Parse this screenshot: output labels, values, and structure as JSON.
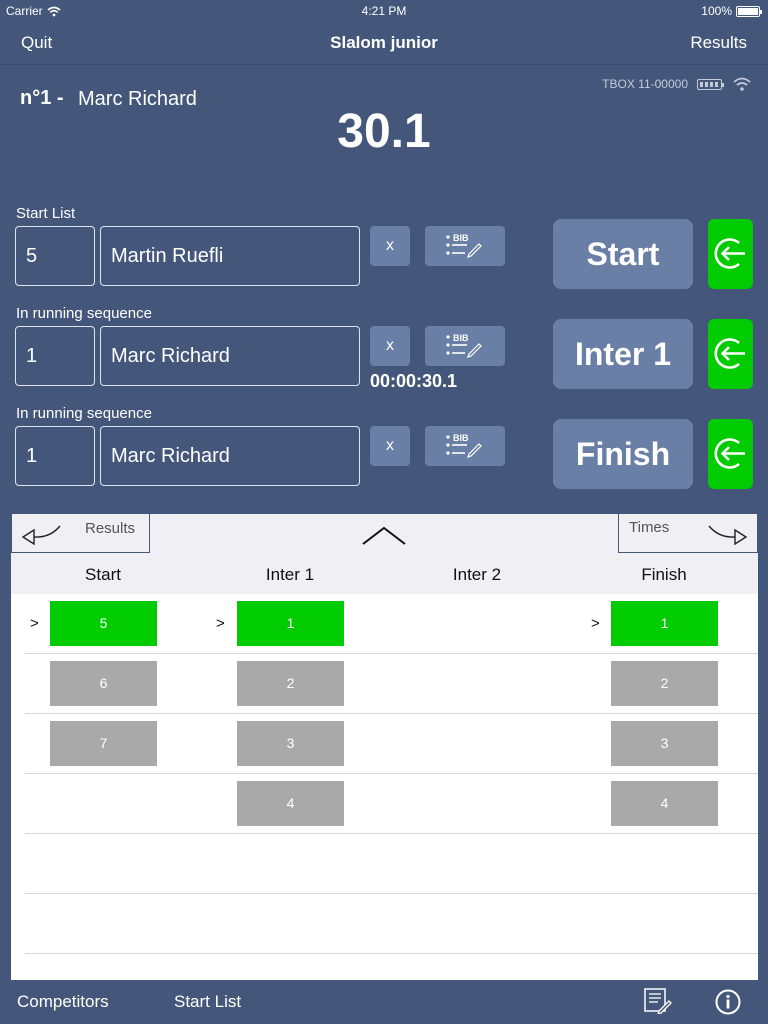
{
  "status_bar": {
    "carrier": "Carrier",
    "time": "4:21 PM",
    "battery": "100%"
  },
  "nav": {
    "quit": "Quit",
    "title": "Slalom junior",
    "results": "Results"
  },
  "device": {
    "id": "TBOX 11-00000"
  },
  "current_runner": {
    "number": "n°1 -",
    "name": "Marc Richard",
    "time": "30.1"
  },
  "rows": [
    {
      "label": "Start List",
      "bib": "5",
      "name": "Martin Ruefli",
      "clear": "x",
      "bib_icon_text": "BIB",
      "action": "Start",
      "time": ""
    },
    {
      "label": "In running sequence",
      "bib": "1",
      "name": "Marc Richard",
      "clear": "x",
      "bib_icon_text": "BIB",
      "action": "Inter 1",
      "time": "00:00:30.1"
    },
    {
      "label": "In running sequence",
      "bib": "1",
      "name": "Marc Richard",
      "clear": "x",
      "bib_icon_text": "BIB",
      "action": "Finish",
      "time": ""
    }
  ],
  "panel": {
    "left_tab": "Results",
    "right_tab": "Times",
    "columns": [
      "Start",
      "Inter 1",
      "Inter 2",
      "Finish"
    ],
    "start": [
      "5",
      "6",
      "7"
    ],
    "inter1": [
      "1",
      "2",
      "3",
      "4"
    ],
    "inter2": [],
    "finish": [
      "1",
      "2",
      "3",
      "4"
    ],
    "marker": ">"
  },
  "bottom_bar": {
    "competitors": "Competitors",
    "start_list": "Start List"
  },
  "colors": {
    "background": "#44577a",
    "button": "#6a7fa6",
    "go": "#00cc00",
    "chip_gray": "#a9a9a9"
  }
}
